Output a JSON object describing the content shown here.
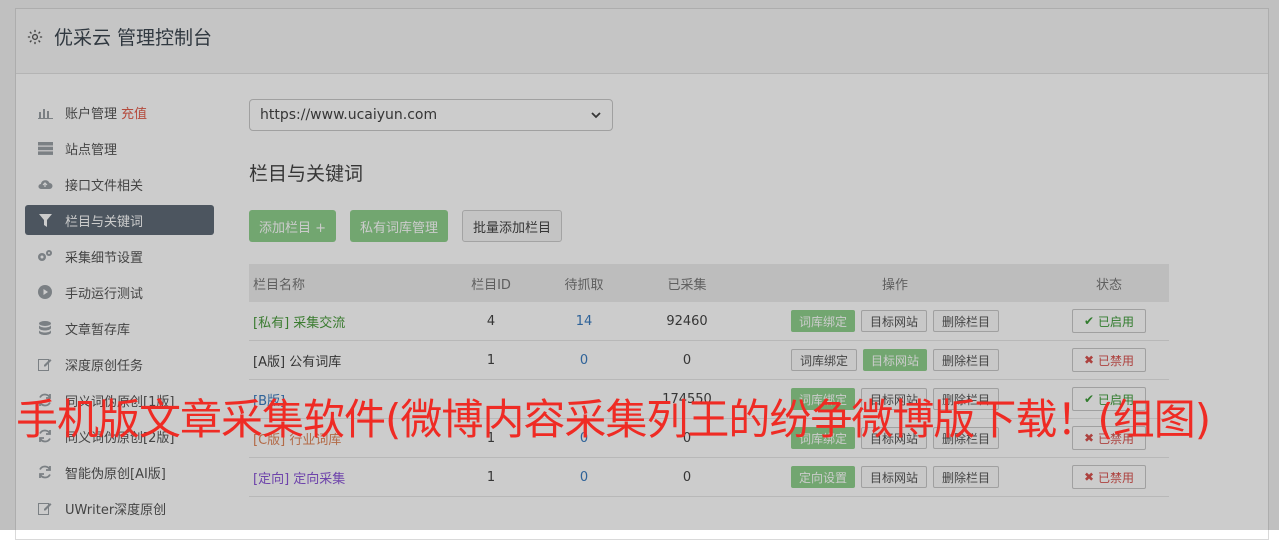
{
  "header": {
    "title": "优采云 管理控制台",
    "icon": "gear-icon"
  },
  "sidebar": {
    "items": [
      {
        "label": "账户管理",
        "extra": "充值",
        "icon": "bar-chart-icon",
        "active": false
      },
      {
        "label": "站点管理",
        "extra": "",
        "icon": "server-icon",
        "active": false
      },
      {
        "label": "接口文件相关",
        "extra": "",
        "icon": "cloud-upload-icon",
        "active": false
      },
      {
        "label": "栏目与关键词",
        "extra": "",
        "icon": "filter-icon",
        "active": true
      },
      {
        "label": "采集细节设置",
        "extra": "",
        "icon": "gears-icon",
        "active": false
      },
      {
        "label": "手动运行测试",
        "extra": "",
        "icon": "play-circle-icon",
        "active": false
      },
      {
        "label": "文章暂存库",
        "extra": "",
        "icon": "database-icon",
        "active": false
      },
      {
        "label": "深度原创任务",
        "extra": "",
        "icon": "edit-icon",
        "active": false
      },
      {
        "label": "同义词伪原创[1版]",
        "extra": "",
        "icon": "refresh-icon",
        "active": false
      },
      {
        "label": "同义词伪原创[2版]",
        "extra": "",
        "icon": "refresh-icon",
        "active": false
      },
      {
        "label": "智能伪原创[AI版]",
        "extra": "",
        "icon": "refresh-icon",
        "active": false
      },
      {
        "label": "UWriter深度原创",
        "extra": "",
        "icon": "edit-icon",
        "active": false
      }
    ]
  },
  "main": {
    "site_select": "https://www.ucaiyun.com",
    "section_title": "栏目与关键词",
    "buttons": {
      "add": "添加栏目 +",
      "private_lib": "私有词库管理",
      "batch_add": "批量添加栏目"
    },
    "table": {
      "headers": [
        "栏目名称",
        "栏目ID",
        "待抓取",
        "已采集",
        "操作",
        "状态"
      ],
      "rows": [
        {
          "tag": "[私有]",
          "name": "采集交流",
          "id": "4",
          "pending": "14",
          "collected": "92460",
          "op1": "词库绑定",
          "op2": "目标网站",
          "op3": "删除栏目",
          "status": "已启用"
        },
        {
          "tag": "[A版]",
          "name": "公有词库",
          "id": "1",
          "pending": "0",
          "collected": "0",
          "op1": "词库绑定",
          "op2": "目标网站",
          "op3": "删除栏目",
          "status": "已禁用"
        },
        {
          "tag": "[B版]",
          "name": "",
          "id": "",
          "pending": "",
          "collected": "174550",
          "op1": "词库绑定",
          "op2": "目标网站",
          "op3": "删除栏目",
          "status": "已启用"
        },
        {
          "tag": "[C版]",
          "name": "行业词库",
          "id": "1",
          "pending": "0",
          "collected": "0",
          "op1": "词库绑定",
          "op2": "目标网站",
          "op3": "删除栏目",
          "status": "已禁用"
        },
        {
          "tag": "[定向]",
          "name": "定向采集",
          "id": "1",
          "pending": "0",
          "collected": "0",
          "op1": "定向设置",
          "op2": "目标网站",
          "op3": "删除栏目",
          "status": "已禁用"
        }
      ]
    }
  },
  "overlay_text": "手机版文章采集软件(微博内容采集列王的纷争微博版下载！(组图)",
  "colors": {
    "green": "#8fd08d",
    "active_nav": "#5f6b77",
    "headline": "#ef2b24"
  }
}
